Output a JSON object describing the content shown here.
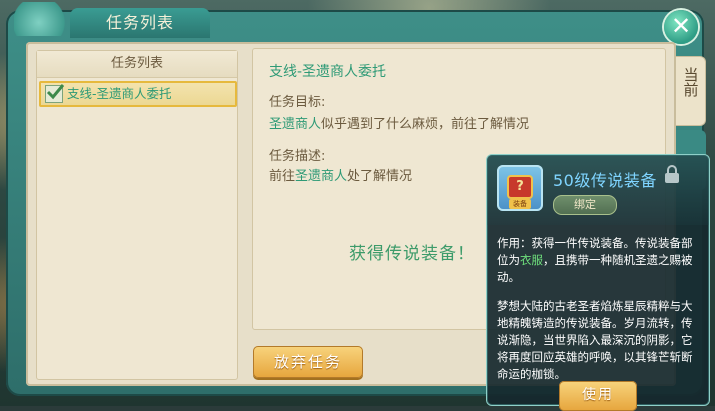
{
  "window": {
    "title": "任务列表",
    "close_icon": "close-icon"
  },
  "list": {
    "header": "任务列表",
    "items": [
      {
        "label": "支线-圣遗商人委托",
        "checked": true
      }
    ]
  },
  "detail": {
    "title": "支线-圣遗商人委托",
    "goal_label": "任务目标:",
    "goal_prefix": "圣遗商人",
    "goal_suffix": "似乎遇到了什么麻烦，前往了解情况",
    "desc_label": "任务描述:",
    "desc_prefix": "前往",
    "desc_npc": "圣遗商人",
    "desc_suffix": "处了解情况",
    "reward_text": "获得传说装备！"
  },
  "abandon_button": "放弃任务",
  "side_tab": "当前",
  "tooltip": {
    "item_name": "50级传说装备",
    "item_icon": "treasure-chest-icon",
    "icon_tag": "装备",
    "icon_glyph": "?",
    "bind_label": "绑定",
    "effect_line1_a": "作用：获得一件传说装备。传说装备部位为",
    "effect_highlight": "衣服",
    "effect_line1_b": "，且携带一种随机圣遗之赐被动。",
    "lore": "梦想大陆的古老圣者焰炼星辰精粹与大地精魄铸造的传说装备。岁月流转，传说渐隐，当世界陷入最深沉的阴影，它将再度回应英雄的呼唤，以其锋芒斩断命运的枷锁。",
    "use_button": "使用"
  },
  "colors": {
    "accent_green": "#2e9a76",
    "button_gold": "#e6a53c",
    "item_name_blue": "#7fd4ff",
    "panel_teal": "#3e8f88"
  }
}
